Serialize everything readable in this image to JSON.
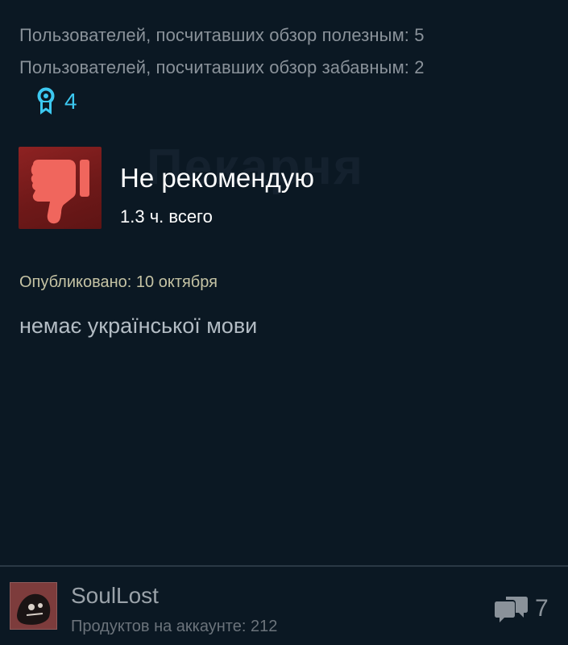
{
  "stats": {
    "helpful": "Пользователей, посчитавших обзор полезным: 5",
    "funny": "Пользователей, посчитавших обзор забавным: 2"
  },
  "award": {
    "icon": "award-ribbon-icon",
    "count": "4",
    "color": "#3cc8f0"
  },
  "watermark": "Пекарня",
  "review": {
    "verdict_icon": "thumbs-down-icon",
    "verdict": "Не рекомендую",
    "hours": "1.3 ч. всего",
    "posted": "Опубликовано: 10 октября",
    "text": "немає української мови"
  },
  "author": {
    "name": "SoulLost",
    "products": "Продуктов на аккаунте: 212",
    "avatar_color": "#7a3b3b"
  },
  "comments": {
    "icon": "comments-icon",
    "count": "7"
  },
  "colors": {
    "background": "#0b1823",
    "verdict_bg": "#7a1e1e",
    "thumb": "#f0665d"
  }
}
